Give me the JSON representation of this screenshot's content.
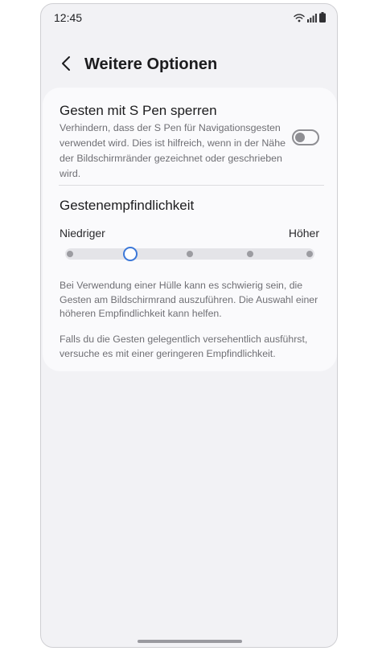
{
  "status_bar": {
    "time": "12:45",
    "icons": [
      "wifi-icon",
      "signal-icon",
      "battery-icon"
    ]
  },
  "header": {
    "back_icon": "chevron-left-icon",
    "title": "Weitere Optionen"
  },
  "lock_gestures": {
    "title": "Gesten mit S Pen sperren",
    "description": "Verhindern, dass der S Pen für Navigationsgesten verwendet wird. Dies ist hilfreich, wenn in der Nähe der Bildschirmränder gezeichnet oder geschrieben wird.",
    "enabled": false
  },
  "sensitivity": {
    "title": "Gestenempfindlichkeit",
    "low_label": "Niedriger",
    "high_label": "Höher",
    "steps": 5,
    "selected_step": 1,
    "info_1": "Bei Verwendung einer Hülle kann es schwierig sein, die Gesten am Bildschirmrand auszuführen. Die Auswahl einer höheren Empfindlichkeit kann helfen.",
    "info_2": "Falls du die Gesten gelegentlich versehentlich ausführst, versuche es mit einer geringeren Empfindlichkeit."
  },
  "colors": {
    "accent": "#3c78d8",
    "background": "#f2f2f5",
    "card": "#fafafc"
  }
}
